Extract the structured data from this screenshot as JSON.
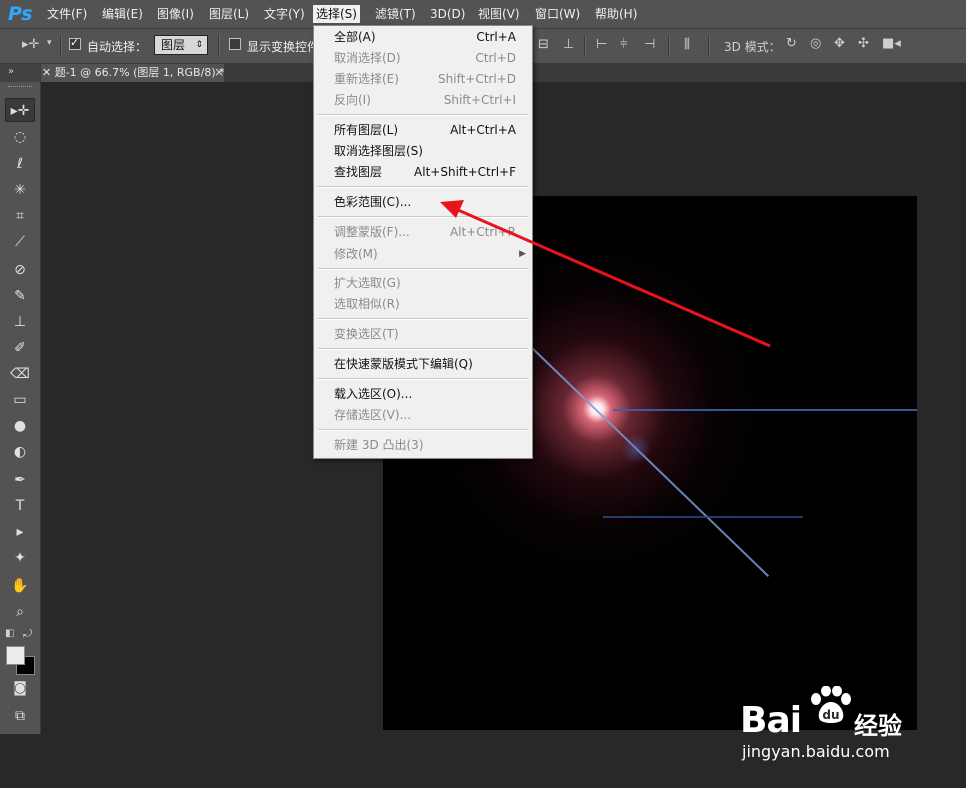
{
  "app": {
    "logo": "Ps"
  },
  "menubar": [
    "文件(F)",
    "编辑(E)",
    "图像(I)",
    "图层(L)",
    "文字(Y)",
    "选择(S)",
    "滤镜(T)",
    "3D(D)",
    "视图(V)",
    "窗口(W)",
    "帮助(H)"
  ],
  "options": {
    "auto_select_label": "自动选择：",
    "auto_select_value": "图层",
    "show_transform_label": "显示变换控件",
    "mode_label": "3D 模式："
  },
  "document": {
    "tab_title": "✕ 题-1 @ 66.7% (图层 1, RGB/8) *",
    "close": "×"
  },
  "select_menu": {
    "all": {
      "label": "全部(A)",
      "shortcut": "Ctrl+A"
    },
    "deselect": {
      "label": "取消选择(D)",
      "shortcut": "Ctrl+D"
    },
    "reselect": {
      "label": "重新选择(E)",
      "shortcut": "Shift+Ctrl+D"
    },
    "inverse": {
      "label": "反向(I)",
      "shortcut": "Shift+Ctrl+I"
    },
    "all_layers": {
      "label": "所有图层(L)",
      "shortcut": "Alt+Ctrl+A"
    },
    "deselect_layers": {
      "label": "取消选择图层(S)"
    },
    "find_layers": {
      "label": "查找图层",
      "shortcut": "Alt+Shift+Ctrl+F"
    },
    "color_range": {
      "label": "色彩范围(C)..."
    },
    "refine_mask": {
      "label": "调整蒙版(F)...",
      "shortcut": "Alt+Ctrl+R"
    },
    "modify": {
      "label": "修改(M)"
    },
    "grow": {
      "label": "扩大选取(G)"
    },
    "similar": {
      "label": "选取相似(R)"
    },
    "transform": {
      "label": "变换选区(T)"
    },
    "quick_mask": {
      "label": "在快速蒙版模式下编辑(Q)"
    },
    "load": {
      "label": "载入选区(O)..."
    },
    "save": {
      "label": "存储选区(V)..."
    },
    "new3d": {
      "label": "新建 3D 凸出(3)"
    }
  },
  "watermark": {
    "brand": "Bai",
    "brand_cn": "经验",
    "url": "jingyan.baidu.com"
  },
  "colors": {
    "accent": "#31a8ff",
    "arrow": "#e8131c",
    "menu_bg": "#f0f0f0",
    "ui_bg": "#535353"
  }
}
